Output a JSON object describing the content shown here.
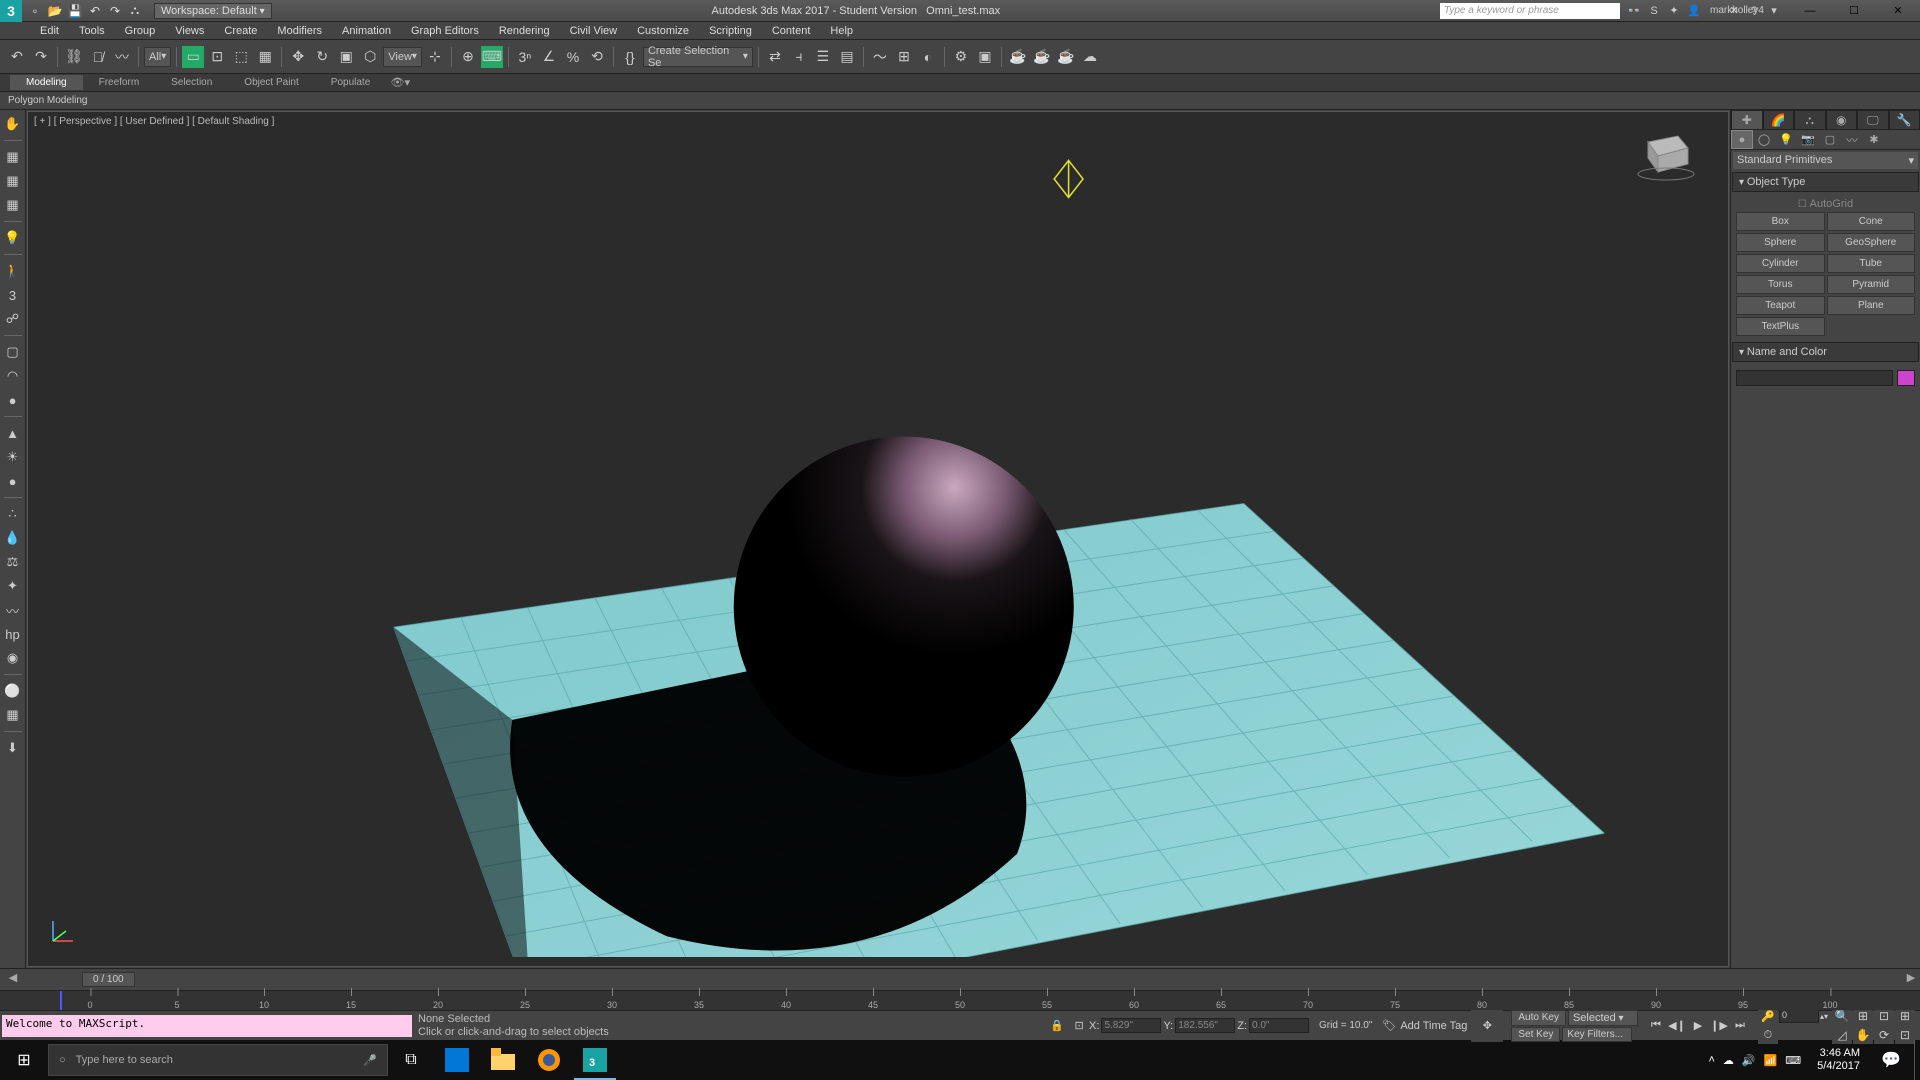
{
  "title": {
    "app": "Autodesk 3ds Max 2017 - Student Version",
    "file": "Omni_test.max",
    "workspace": "Workspace: Default",
    "search_placeholder": "Type a keyword or phrase",
    "user": "markholley4"
  },
  "menu": [
    "Edit",
    "Tools",
    "Group",
    "Views",
    "Create",
    "Modifiers",
    "Animation",
    "Graph Editors",
    "Rendering",
    "Civil View",
    "Customize",
    "Scripting",
    "Content",
    "Help"
  ],
  "maintool": {
    "all": "All",
    "view": "View",
    "selset": "Create Selection Se"
  },
  "ribbon": {
    "tabs": [
      "Modeling",
      "Freeform",
      "Selection",
      "Object Paint",
      "Populate"
    ],
    "sub": "Polygon Modeling"
  },
  "viewport_label": "[ + ] [ Perspective ] [ User Defined ] [ Default Shading ]",
  "cmdpanel": {
    "dropdown": "Standard Primitives",
    "rollout_type": "Object Type",
    "autogrid": "AutoGrid",
    "buttons": [
      [
        "Box",
        "Cone"
      ],
      [
        "Sphere",
        "GeoSphere"
      ],
      [
        "Cylinder",
        "Tube"
      ],
      [
        "Torus",
        "Pyramid"
      ],
      [
        "Teapot",
        "Plane"
      ],
      [
        "TextPlus",
        ""
      ]
    ],
    "rollout_name": "Name and Color"
  },
  "timeslider": "0 / 100",
  "timeline_ticks": [
    0,
    5,
    10,
    15,
    20,
    25,
    30,
    35,
    40,
    45,
    50,
    55,
    60,
    65,
    70,
    75,
    80,
    85,
    90,
    95,
    100
  ],
  "status": {
    "maxscript": "Welcome to MAXScript.",
    "sel": "None Selected",
    "prompt": "Click or click-and-drag to select objects",
    "x": "5.829\"",
    "y": "182.556\"",
    "z": "0.0\"",
    "grid": "Grid = 10.0\"",
    "addtag": "Add Time Tag",
    "autokey": "Auto Key",
    "setkey": "Set Key",
    "selected": "Selected",
    "keyfilters": "Key Filters...",
    "frame": "0"
  },
  "taskbar": {
    "search": "Type here to search",
    "time": "3:46 AM",
    "date": "5/4/2017"
  }
}
